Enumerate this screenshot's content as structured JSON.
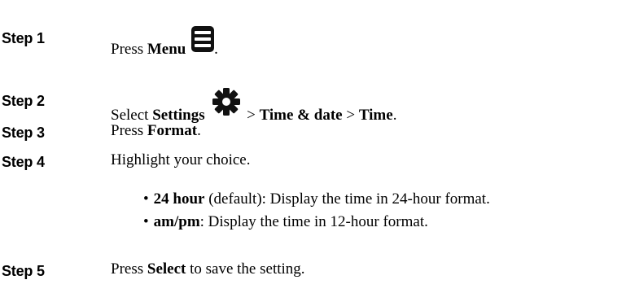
{
  "steps": [
    {
      "label": "Step 1",
      "pre": "Press ",
      "bold": "Menu",
      "post": ".",
      "icon": "menu-icon"
    },
    {
      "label": "Step 2",
      "pre": "Select ",
      "bold1": "Settings",
      "sep1": " > ",
      "bold2": "Time & date",
      "sep2": " > ",
      "bold3": "Time",
      "post": ".",
      "icon": "settings-gear-icon"
    },
    {
      "label": "Step 3",
      "pre": "Press ",
      "bold": "Format",
      "post": "."
    },
    {
      "label": "Step 4",
      "text": "Highlight your choice.",
      "options": [
        {
          "bullet": "•",
          "bold": "24 hour",
          "rest": " (default): Display the time in 24-hour format."
        },
        {
          "bullet": "•",
          "bold": "am/pm",
          "rest": ": Display the time in 12-hour format."
        }
      ]
    },
    {
      "label": "Step 5",
      "pre": "Press ",
      "bold": "Select",
      "post": " to save the setting."
    }
  ]
}
